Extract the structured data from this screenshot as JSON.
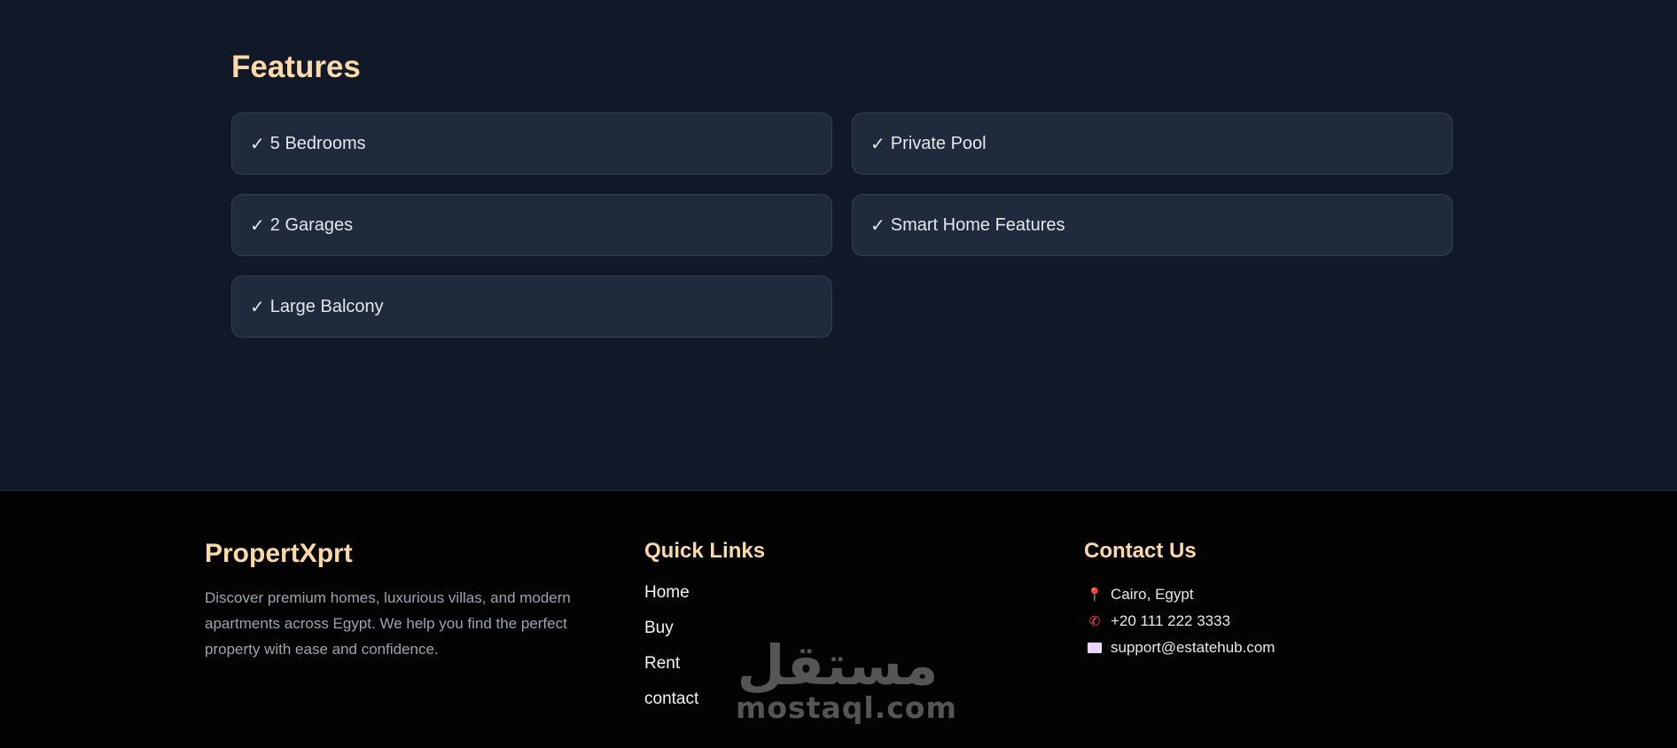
{
  "features": {
    "title": "Features",
    "check_mark": "✓",
    "items": [
      {
        "label": "5 Bedrooms"
      },
      {
        "label": "Private Pool"
      },
      {
        "label": "2 Garages"
      },
      {
        "label": "Smart Home Features"
      },
      {
        "label": "Large Balcony"
      }
    ]
  },
  "footer": {
    "brand": "PropertXprt",
    "description": "Discover premium homes, luxurious villas, and modern apartments across Egypt. We help you find the perfect property with ease and confidence.",
    "quick_links": {
      "title": "Quick Links",
      "items": [
        "Home",
        "Buy",
        "Rent",
        "contact"
      ]
    },
    "contact": {
      "title": "Contact Us",
      "location": "Cairo, Egypt",
      "location_icon": "pin-icon",
      "phone": "+20 111 222 3333",
      "phone_icon": "phone-icon",
      "email": "support@estatehub.com",
      "email_icon": "envelope-icon"
    }
  },
  "watermark": {
    "arabic": "مستقل",
    "latin": "mostaql.com"
  },
  "colors": {
    "background": "#111827",
    "footer_background": "#030303",
    "accent": "#fcd9a8",
    "card": "#1f2a3c"
  }
}
